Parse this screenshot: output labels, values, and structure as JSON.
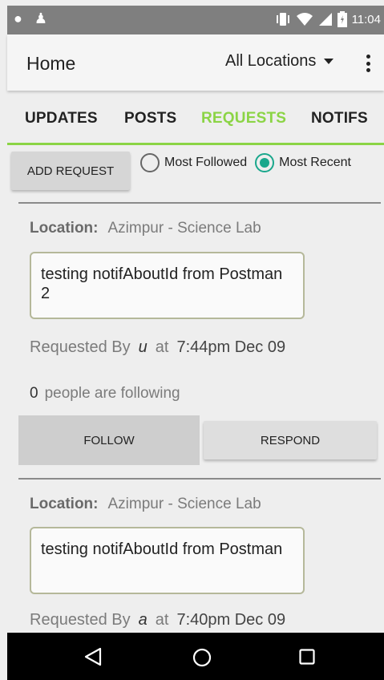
{
  "status_bar": {
    "time": "11:04"
  },
  "app_bar": {
    "title": "Home",
    "location_filter": "All Locations"
  },
  "tabs": [
    {
      "label": "UPDATES",
      "active": false
    },
    {
      "label": "POSTS",
      "active": false
    },
    {
      "label": "REQUESTS",
      "active": true
    },
    {
      "label": "NOTIFS",
      "active": false
    }
  ],
  "toolbar": {
    "add_request_label": "ADD REQUEST",
    "sort_options": [
      {
        "label": "Most Followed",
        "checked": false
      },
      {
        "label": "Most Recent",
        "checked": true
      }
    ]
  },
  "requests": [
    {
      "location_label": "Location:",
      "location": "Azimpur - Science Lab",
      "text": "testing notifAboutId from Postman 2",
      "requested_by_label": "Requested By",
      "user": "u",
      "at_label": "at",
      "time": "7:44pm Dec 09",
      "followers_count": "0",
      "followers_label": "people are following",
      "follow_label": "FOLLOW",
      "respond_label": "RESPOND"
    },
    {
      "location_label": "Location:",
      "location": "Azimpur - Science Lab",
      "text": "testing notifAboutId from Postman",
      "requested_by_label": "Requested By",
      "user": "a",
      "at_label": "at",
      "time": "7:40pm Dec 09"
    }
  ],
  "colors": {
    "accent": "#8bd445",
    "radio": "#1aa78c"
  },
  "icons": {
    "status_left": [
      "notification-icon",
      "android-icon"
    ],
    "status_right": [
      "vibrate-icon",
      "wifi-icon",
      "signal-icon",
      "battery-icon"
    ],
    "nav": [
      "back-icon",
      "home-icon",
      "recents-icon"
    ]
  }
}
